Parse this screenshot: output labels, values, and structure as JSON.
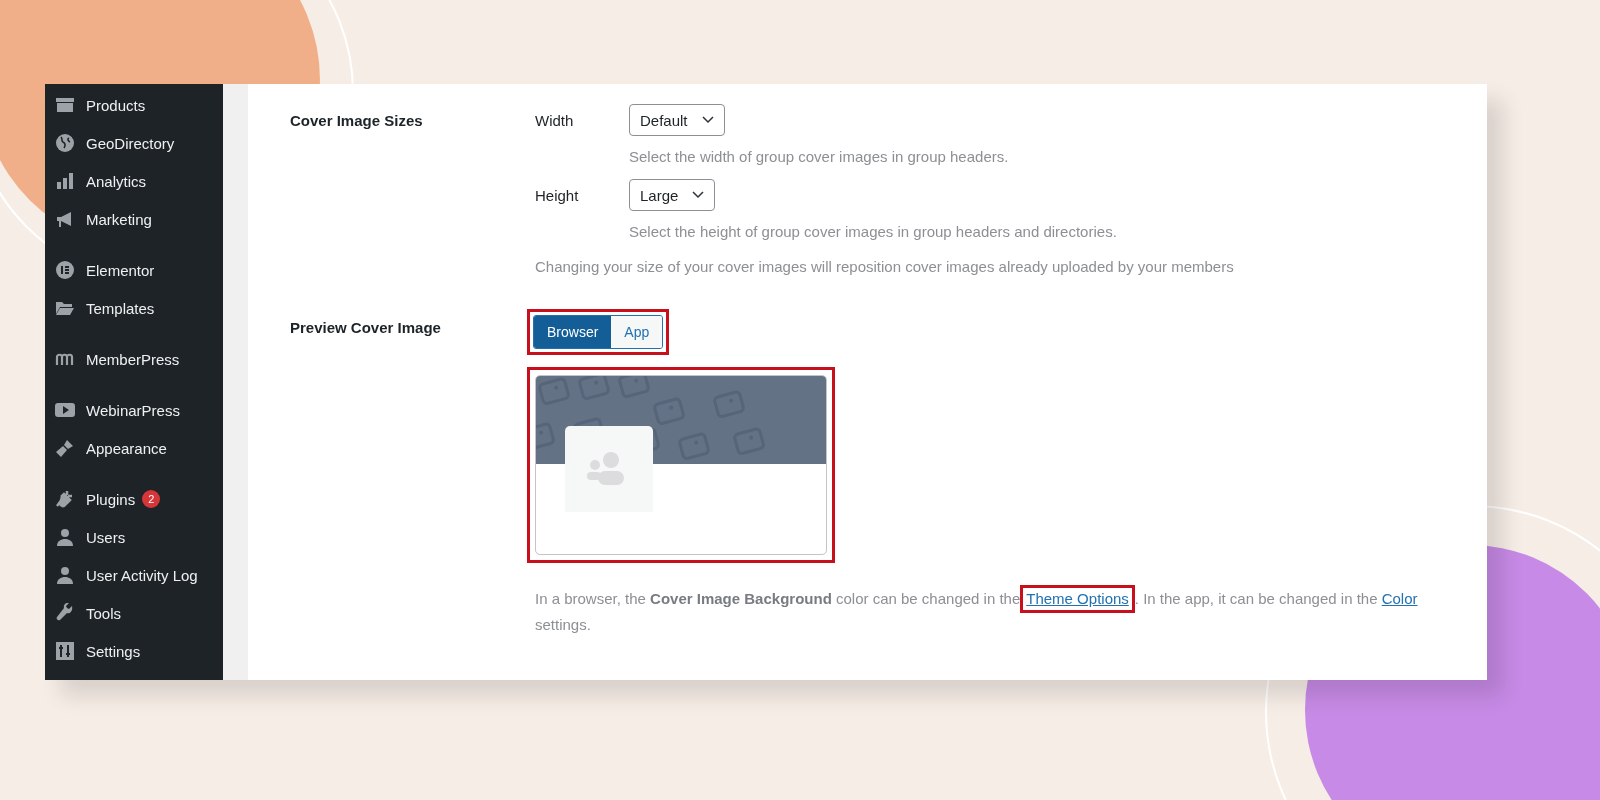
{
  "sidebar": {
    "groups": [
      [
        {
          "label": "Products"
        },
        {
          "label": "GeoDirectory"
        },
        {
          "label": "Analytics"
        },
        {
          "label": "Marketing"
        }
      ],
      [
        {
          "label": "Elementor"
        },
        {
          "label": "Templates"
        }
      ],
      [
        {
          "label": "MemberPress"
        }
      ],
      [
        {
          "label": "WebinarPress"
        },
        {
          "label": "Appearance"
        }
      ],
      [
        {
          "label": "Plugins",
          "badge": "2"
        },
        {
          "label": "Users"
        },
        {
          "label": "User Activity Log"
        },
        {
          "label": "Tools"
        },
        {
          "label": "Settings"
        }
      ]
    ]
  },
  "cover_image_sizes": {
    "title": "Cover Image Sizes",
    "fields": [
      {
        "label": "Width",
        "value": "Default",
        "help": "Select the width of group cover images in group headers."
      },
      {
        "label": "Height",
        "value": "Large",
        "help": "Select the height of group cover images in group headers and directories."
      }
    ],
    "note": "Changing your size of your cover images will reposition cover images already uploaded by your members"
  },
  "preview": {
    "title": "Preview Cover Image",
    "toggle_highlighted": true,
    "toggle": [
      {
        "label": "Browser",
        "selected": true
      },
      {
        "label": "App",
        "selected": false
      }
    ],
    "image_highlighted": true,
    "note": {
      "text_1": "In a browser, the **Cover Image Background** color can be changed in the",
      "link_1": "Theme Options",
      "link_1_highlighted": true,
      "text_2": ". In the app, it can be changed in the",
      "link_2": "Color",
      "text_3": "settings."
    }
  }
}
